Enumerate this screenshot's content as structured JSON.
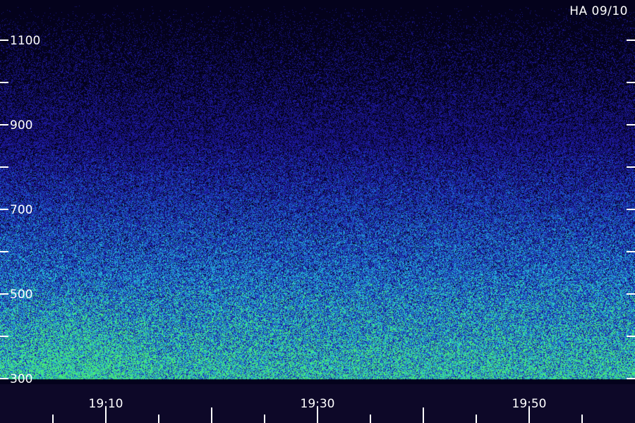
{
  "station_label": "HA 09/10",
  "colors": {
    "background": "#000000",
    "low": "#1a1a8c",
    "mid": "#1e6fd0",
    "high": "#2ee6a0",
    "peak": "#50ff50",
    "axis": "#ffffff"
  },
  "chart_data": {
    "type": "heatmap",
    "title": "",
    "xlabel": "",
    "ylabel": "",
    "x_ticks": [
      "19:10",
      "19:30",
      "19:50"
    ],
    "y_ticks": [
      300,
      500,
      700,
      900,
      1100
    ],
    "xlim": [
      "19:00",
      "19:59"
    ],
    "ylim": [
      300,
      1200
    ],
    "minor_y_ticks": [
      400,
      600,
      800,
      1000,
      1200
    ],
    "colormap": "dark-blue to blue to cyan-green",
    "grid": false,
    "intensity_by_frequency": [
      {
        "freq": 300,
        "level": 0.85
      },
      {
        "freq": 400,
        "level": 0.7
      },
      {
        "freq": 500,
        "level": 0.6
      },
      {
        "freq": 600,
        "level": 0.5
      },
      {
        "freq": 700,
        "level": 0.42
      },
      {
        "freq": 800,
        "level": 0.33
      },
      {
        "freq": 900,
        "level": 0.26
      },
      {
        "freq": 1000,
        "level": 0.2
      },
      {
        "freq": 1100,
        "level": 0.17
      },
      {
        "freq": 1200,
        "level": 0.15
      }
    ],
    "bright_region": {
      "x_start": "19:00",
      "x_end": "19:15",
      "freq_max": 500
    }
  }
}
